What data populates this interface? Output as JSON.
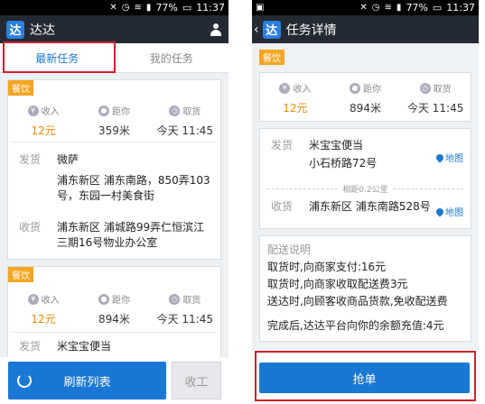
{
  "status": {
    "battery": "77%",
    "time": "11:37"
  },
  "left": {
    "app_title": "达达",
    "tabs": [
      "最新任务",
      "我的任务"
    ],
    "cards": [
      {
        "badge": "餐饮",
        "stats": [
          {
            "label": "收入",
            "value": "12元",
            "icon": "yen-icon"
          },
          {
            "label": "距你",
            "value": "359米",
            "icon": "location-icon"
          },
          {
            "label": "取货",
            "value": "今天 11:45",
            "icon": "clock-icon"
          }
        ],
        "ship_label": "发货",
        "ship_name": "微萨",
        "ship_addr": "浦东新区 浦东南路，850弄103号，东园一村美食街",
        "recv_label": "收货",
        "recv_addr": "浦东新区 浦城路99弄仁恒滨江三期16号物业办公室"
      },
      {
        "badge": "餐饮",
        "stats": [
          {
            "label": "收入",
            "value": "12元",
            "icon": "yen-icon"
          },
          {
            "label": "距你",
            "value": "894米",
            "icon": "location-icon"
          },
          {
            "label": "取货",
            "value": "今天 11:45",
            "icon": "clock-icon"
          }
        ],
        "ship_label": "发货",
        "ship_name": "米宝宝便当"
      }
    ],
    "refresh_button": "刷新列表",
    "offwork_button": "收工"
  },
  "right": {
    "title": "任务详情",
    "badge": "餐饮",
    "stats": [
      {
        "label": "收入",
        "value": "12元",
        "icon": "yen-icon"
      },
      {
        "label": "距你",
        "value": "894米",
        "icon": "location-icon"
      },
      {
        "label": "取货",
        "value": "今天 11:45",
        "icon": "clock-icon"
      }
    ],
    "ship_label": "发货",
    "ship_name": "米宝宝便当",
    "ship_addr": "小石桥路72号",
    "map_link": "地图",
    "distance_note": "相距0.2公里",
    "recv_label": "收货",
    "recv_addr": "浦东新区 浦东南路528号",
    "note_title": "配送说明",
    "notes": [
      "取货时,向商家支付:16元",
      "取货时,向商家收取配送费3元",
      "送达时,向顾客收商品货款,免收配送费",
      "完成后,达达平台向你的余额充值:4元"
    ],
    "grab_button": "抢单"
  }
}
